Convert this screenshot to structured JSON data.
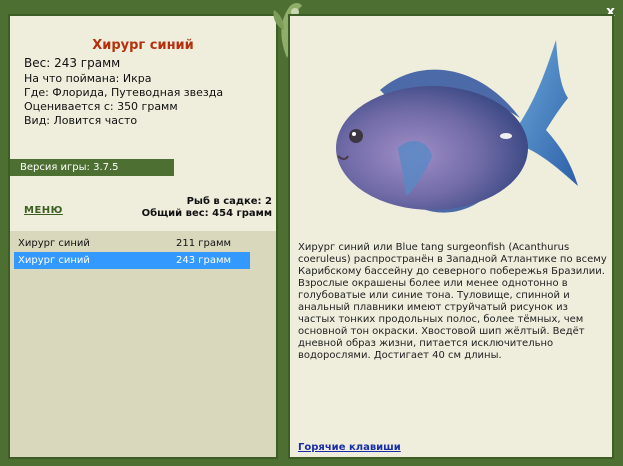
{
  "fish": {
    "name": "Хирург синий",
    "weight": "Вес: 243 грамм",
    "bait": "На что поймана: Икра",
    "location": "Где: Флорида, Путеводная звезда",
    "rated_from": "Оценивается с: 350 грамм",
    "status": "Вид: Ловится часто"
  },
  "game": {
    "version": "Версия игры: 3.7.5"
  },
  "menu": {
    "label": "МЕНЮ"
  },
  "cage": {
    "count": "Рыб в садке: 2",
    "total_weight": "Общий вес: 454 грамм"
  },
  "catch_list": [
    {
      "name": "Хирург синий",
      "weight": "211 грамм"
    },
    {
      "name": "Хирург синий",
      "weight": "243 грамм"
    }
  ],
  "description": "Хирург синий или Blue tang surgeonfish (Acanthurus coeruleus) распространён в Западной Атлантике по всему Карибскому бассейну до северного побережья Бразилии. Взрослые окрашены более или менее однотонно в голубоватые или синие тона. Туловище, спинной и анальный плавники имеют струйчатый рисунок из частых тонких продольных полос, более тёмных, чем основной тон окраски. Хвостовой шип жёлтый. Ведёт дневной образ жизни, питается исключительно водорослями. Достигает 40 см длины.",
  "hotkeys": {
    "label": "Горячие клавиши"
  },
  "window": {
    "close": "x"
  },
  "colors": {
    "frame": "#4d6f31",
    "panel": "#efeedd",
    "title": "#b5300c",
    "selection": "#3399ff",
    "link": "#1a2ea8"
  }
}
